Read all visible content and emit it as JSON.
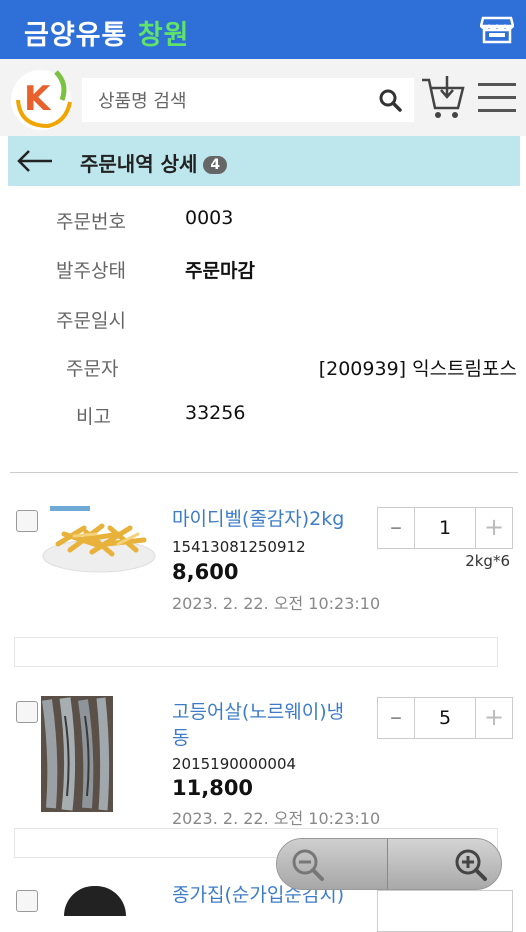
{
  "app": {
    "title_main": "금양유통",
    "title_highlight": "창원"
  },
  "search": {
    "placeholder": "상품명 검색"
  },
  "page": {
    "title": "주문내역 상세",
    "badge_count": "4"
  },
  "order": {
    "fields": [
      {
        "label": "주문번호",
        "value": "0003"
      },
      {
        "label": "발주상태",
        "value": "주문마감"
      },
      {
        "label": "주문일시",
        "value": ""
      },
      {
        "label": "주문자",
        "value": "[200939] 익스트림포스"
      },
      {
        "label": "비고",
        "value": "33256"
      }
    ]
  },
  "items": [
    {
      "name": "마이디벨(줄감자)2kg",
      "code": "15413081250912",
      "price": "8,600",
      "date": "2023. 2. 22. 오전 10:23:10",
      "qty": "1",
      "unit": "2kg*6"
    },
    {
      "name_line1": "고등어살(노르웨이)냉",
      "name_line2": "동",
      "code": "2015190000004",
      "price": "11,800",
      "date": "2023. 2. 22. 오전 10:23:10",
      "qty": "5",
      "unit": ""
    },
    {
      "name": "종가집(순가입순김치)"
    }
  ],
  "stepper": {
    "minus": "–",
    "plus": "+"
  },
  "icons": [
    "store-icon",
    "search-icon",
    "cart-icon",
    "menu-icon",
    "back-arrow-icon",
    "zoom-out-icon",
    "zoom-in-icon"
  ],
  "colors": {
    "topbar": "#2f6fd8",
    "highlight": "#5fe36a",
    "headerbar": "#bde7ec",
    "product_link": "#3d7cc9"
  }
}
